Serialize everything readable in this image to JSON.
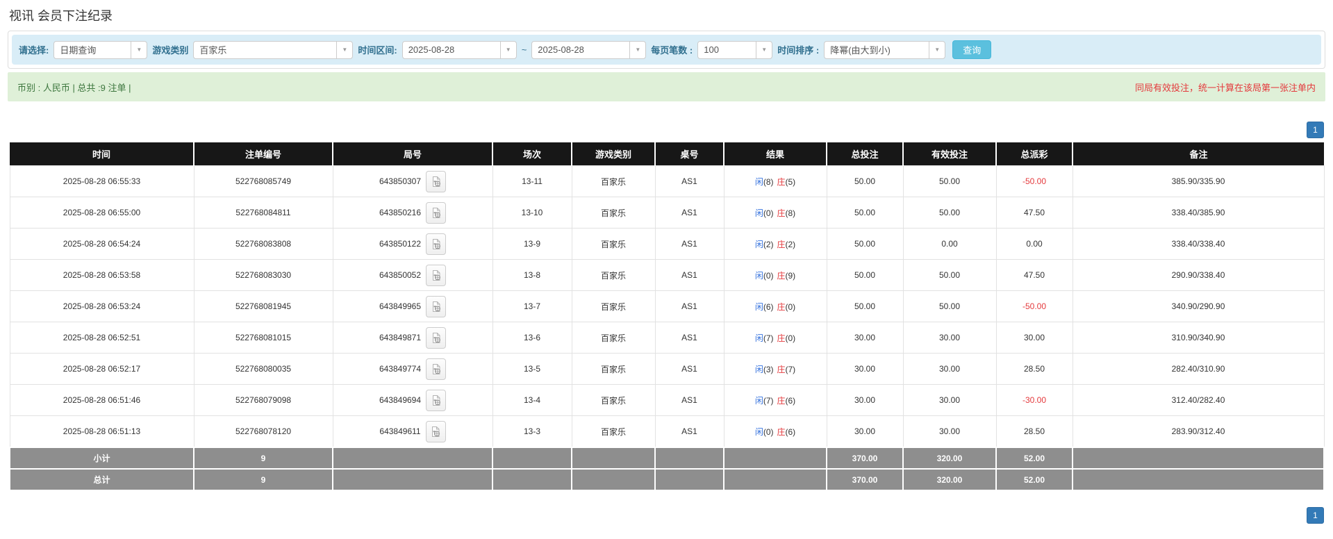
{
  "page": {
    "title": "视讯 会员下注纪录"
  },
  "filters": {
    "select_label": "请选择:",
    "select_value": "日期查询",
    "game_type_label": "游戏类别",
    "game_type_value": "百家乐",
    "date_range_label": "时间区间:",
    "date_from": "2025-08-28",
    "date_separator": "~",
    "date_to": "2025-08-28",
    "page_size_label": "每页笔数 :",
    "page_size_value": "100",
    "sort_label": "时间排序 :",
    "sort_value": "降幂(由大到小)",
    "search_button": "查询"
  },
  "summary": {
    "left": "币别 : 人民币 | 总共 :9 注单 |",
    "right": "同局有效投注，统一计算在该局第一张注单内"
  },
  "pagination": {
    "page": "1"
  },
  "icons": {
    "caret": "▼",
    "round_detail": "video-record-document"
  },
  "colors": {
    "filter_bg": "#d9edf7",
    "summary_bg": "#dff0d8",
    "header_bg": "#171717",
    "gray_row_bg": "#8e8e8e",
    "link_blue": "#3572dd",
    "negative_red": "#e4393c",
    "search_btn": "#5bc0de",
    "pager_blue": "#337ab7"
  },
  "table": {
    "headers": [
      "时间",
      "注单编号",
      "局号",
      "场次",
      "游戏类别",
      "桌号",
      "结果",
      "总投注",
      "有效投注",
      "总派彩",
      "备注"
    ],
    "rows": [
      {
        "time": "2025-08-28 06:55:33",
        "bet_id": "522768085749",
        "round": "643850307",
        "session": "13-11",
        "game": "百家乐",
        "table_no": "AS1",
        "player": "闲",
        "player_n": "(8)",
        "banker": "庄",
        "banker_n": "(5)",
        "total_bet": "50.00",
        "valid_bet": "50.00",
        "payout": "-50.00",
        "note": "385.90/335.90"
      },
      {
        "time": "2025-08-28 06:55:00",
        "bet_id": "522768084811",
        "round": "643850216",
        "session": "13-10",
        "game": "百家乐",
        "table_no": "AS1",
        "player": "闲",
        "player_n": "(0)",
        "banker": "庄",
        "banker_n": "(8)",
        "total_bet": "50.00",
        "valid_bet": "50.00",
        "payout": "47.50",
        "note": "338.40/385.90"
      },
      {
        "time": "2025-08-28 06:54:24",
        "bet_id": "522768083808",
        "round": "643850122",
        "session": "13-9",
        "game": "百家乐",
        "table_no": "AS1",
        "player": "闲",
        "player_n": "(2)",
        "banker": "庄",
        "banker_n": "(2)",
        "total_bet": "50.00",
        "valid_bet": "0.00",
        "payout": "0.00",
        "note": "338.40/338.40"
      },
      {
        "time": "2025-08-28 06:53:58",
        "bet_id": "522768083030",
        "round": "643850052",
        "session": "13-8",
        "game": "百家乐",
        "table_no": "AS1",
        "player": "闲",
        "player_n": "(0)",
        "banker": "庄",
        "banker_n": "(9)",
        "total_bet": "50.00",
        "valid_bet": "50.00",
        "payout": "47.50",
        "note": "290.90/338.40"
      },
      {
        "time": "2025-08-28 06:53:24",
        "bet_id": "522768081945",
        "round": "643849965",
        "session": "13-7",
        "game": "百家乐",
        "table_no": "AS1",
        "player": "闲",
        "player_n": "(6)",
        "banker": "庄",
        "banker_n": "(0)",
        "total_bet": "50.00",
        "valid_bet": "50.00",
        "payout": "-50.00",
        "note": "340.90/290.90"
      },
      {
        "time": "2025-08-28 06:52:51",
        "bet_id": "522768081015",
        "round": "643849871",
        "session": "13-6",
        "game": "百家乐",
        "table_no": "AS1",
        "player": "闲",
        "player_n": "(7)",
        "banker": "庄",
        "banker_n": "(0)",
        "total_bet": "30.00",
        "valid_bet": "30.00",
        "payout": "30.00",
        "note": "310.90/340.90"
      },
      {
        "time": "2025-08-28 06:52:17",
        "bet_id": "522768080035",
        "round": "643849774",
        "session": "13-5",
        "game": "百家乐",
        "table_no": "AS1",
        "player": "闲",
        "player_n": "(3)",
        "banker": "庄",
        "banker_n": "(7)",
        "total_bet": "30.00",
        "valid_bet": "30.00",
        "payout": "28.50",
        "note": "282.40/310.90"
      },
      {
        "time": "2025-08-28 06:51:46",
        "bet_id": "522768079098",
        "round": "643849694",
        "session": "13-4",
        "game": "百家乐",
        "table_no": "AS1",
        "player": "闲",
        "player_n": "(7)",
        "banker": "庄",
        "banker_n": "(6)",
        "total_bet": "30.00",
        "valid_bet": "30.00",
        "payout": "-30.00",
        "note": "312.40/282.40"
      },
      {
        "time": "2025-08-28 06:51:13",
        "bet_id": "522768078120",
        "round": "643849611",
        "session": "13-3",
        "game": "百家乐",
        "table_no": "AS1",
        "player": "闲",
        "player_n": "(0)",
        "banker": "庄",
        "banker_n": "(6)",
        "total_bet": "30.00",
        "valid_bet": "30.00",
        "payout": "28.50",
        "note": "283.90/312.40"
      }
    ],
    "subtotal": {
      "label": "小计",
      "count": "9",
      "total_bet": "370.00",
      "valid_bet": "320.00",
      "payout": "52.00"
    },
    "total": {
      "label": "总计",
      "count": "9",
      "total_bet": "370.00",
      "valid_bet": "320.00",
      "payout": "52.00"
    }
  }
}
